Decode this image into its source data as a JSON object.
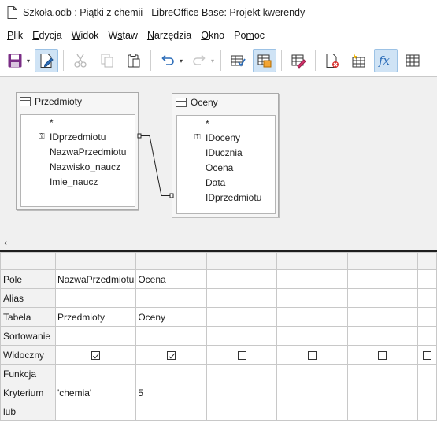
{
  "window": {
    "title": "Szkoła.odb : Piątki z chemii - LibreOffice Base: Projekt kwerendy"
  },
  "menu": [
    {
      "pre": "",
      "u": "P",
      "post": "lik"
    },
    {
      "pre": "",
      "u": "E",
      "post": "dycja"
    },
    {
      "pre": "",
      "u": "W",
      "post": "idok"
    },
    {
      "pre": "W",
      "u": "s",
      "post": "taw"
    },
    {
      "pre": "",
      "u": "N",
      "post": "arzędzia"
    },
    {
      "pre": "",
      "u": "O",
      "post": "kno"
    },
    {
      "pre": "Po",
      "u": "m",
      "post": "oc"
    }
  ],
  "toolbar": {
    "icons": [
      "save-icon",
      "edit-mode-icon",
      "cut-icon",
      "copy-icon",
      "paste-icon",
      "undo-icon",
      "redo-icon",
      "run-query-icon",
      "clear-query-icon",
      "switch-design-view-icon",
      "add-table-icon",
      "new-relation-icon",
      "functions-icon",
      "table-names-icon"
    ]
  },
  "tables": [
    {
      "name": "Przedmioty",
      "fields": [
        "*",
        "IDprzedmiotu",
        "NazwaPrzedmiotu",
        "Nazwisko_naucz",
        "Imie_naucz"
      ],
      "key_field_index": 1
    },
    {
      "name": "Oceny",
      "fields": [
        "*",
        "IDoceny",
        "IDucznia",
        "Ocena",
        "Data",
        "IDprzedmiotu"
      ],
      "key_field_index": 1
    }
  ],
  "grid": {
    "row_labels": [
      "Pole",
      "Alias",
      "Tabela",
      "Sortowanie",
      "Widoczny",
      "Funkcja",
      "Kryterium",
      "lub"
    ],
    "columns": [
      {
        "Pole": "NazwaPrzedmiotu",
        "Alias": "",
        "Tabela": "Przedmioty",
        "Sortowanie": "",
        "Widoczny": true,
        "Funkcja": "",
        "Kryterium": "'chemia'",
        "lub": ""
      },
      {
        "Pole": "Ocena",
        "Alias": "",
        "Tabela": "Oceny",
        "Sortowanie": "",
        "Widoczny": true,
        "Funkcja": "",
        "Kryterium": "5",
        "lub": ""
      },
      {
        "Pole": "",
        "Alias": "",
        "Tabela": "",
        "Sortowanie": "",
        "Widoczny": false,
        "Funkcja": "",
        "Kryterium": "",
        "lub": ""
      },
      {
        "Pole": "",
        "Alias": "",
        "Tabela": "",
        "Sortowanie": "",
        "Widoczny": false,
        "Funkcja": "",
        "Kryterium": "",
        "lub": ""
      },
      {
        "Pole": "",
        "Alias": "",
        "Tabela": "",
        "Sortowanie": "",
        "Widoczny": false,
        "Funkcja": "",
        "Kryterium": "",
        "lub": ""
      },
      {
        "Pole": "",
        "Alias": "",
        "Tabela": "",
        "Sortowanie": "",
        "Widoczny": false,
        "Funkcja": "",
        "Kryterium": "",
        "lub": ""
      }
    ]
  },
  "colors": {
    "accent": "#2b6cb8",
    "active_button_bg": "#cfe3f5",
    "design_bg": "#f0f0f0"
  }
}
